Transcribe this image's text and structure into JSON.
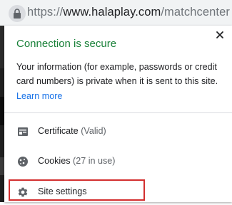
{
  "addressbar": {
    "scheme": "https://",
    "host": "www.halaplay.com",
    "path": "/matchcenter",
    "icon": "lock-icon"
  },
  "popup": {
    "title": "Connection is secure",
    "description": "Your information (for example, passwords or credit card numbers) is private when it is sent to this site.",
    "learn_more": "Learn more",
    "close_icon": "close-icon",
    "title_color": "#188038",
    "link_color": "#1a73e8",
    "rows": [
      {
        "label": "Certificate",
        "detail": "(Valid)",
        "icon": "certificate-icon"
      },
      {
        "label": "Cookies",
        "detail": "(27 in use)",
        "icon": "cookie-icon"
      },
      {
        "label": "Site settings",
        "icon": "gear-icon"
      }
    ],
    "highlight_color": "#d32f2f"
  }
}
